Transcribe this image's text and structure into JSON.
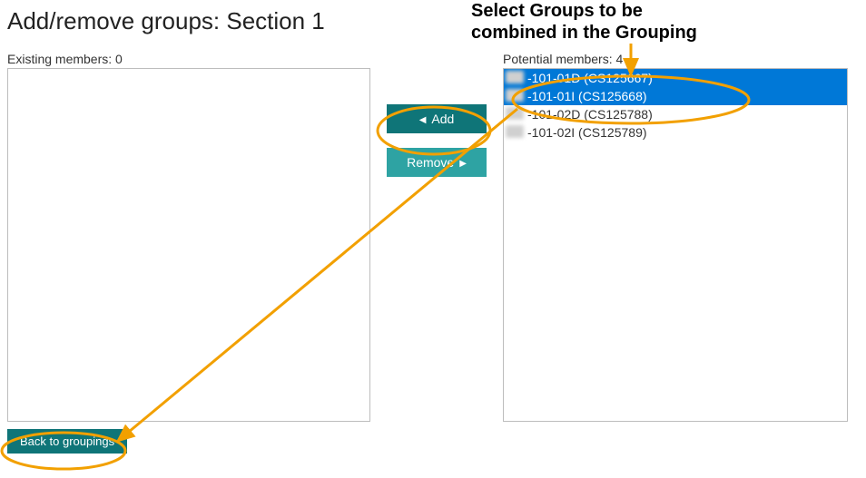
{
  "title": "Add/remove groups: Section 1",
  "existing": {
    "label": "Existing members: 0",
    "items": []
  },
  "potential": {
    "label": "Potential members: 4",
    "items": [
      {
        "text": "-101-01D (CS125667)",
        "selected": true
      },
      {
        "text": "-101-01I (CS125668)",
        "selected": true
      },
      {
        "text": "-101-02D (CS125788)",
        "selected": false
      },
      {
        "text": "-101-02I (CS125789)",
        "selected": false
      }
    ]
  },
  "buttons": {
    "add": "Add",
    "remove": "Remove",
    "back": "Back to groupings"
  },
  "annotation": {
    "line1": "Select Groups to be",
    "line2": "combined in the Grouping"
  }
}
